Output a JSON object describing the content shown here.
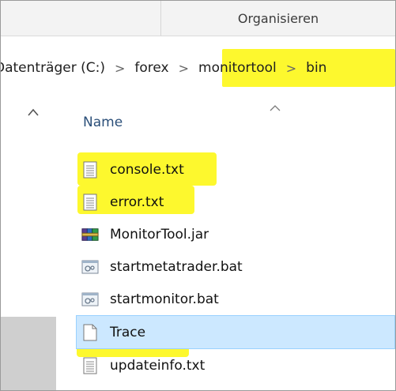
{
  "ribbon": {
    "organize_label": "Organisieren"
  },
  "address": {
    "crumbs": [
      "Datenträger (C:)",
      "forex",
      "monitortool",
      "bin"
    ],
    "separator": ">"
  },
  "columns": {
    "name_label": "Name"
  },
  "files": [
    {
      "name": "console.txt",
      "icon": "text-file-icon",
      "highlighted": true
    },
    {
      "name": "error.txt",
      "icon": "text-file-icon",
      "highlighted": true
    },
    {
      "name": "MonitorTool.jar",
      "icon": "archive-icon",
      "highlighted": false
    },
    {
      "name": "startmetatrader.bat",
      "icon": "batch-file-icon",
      "highlighted": false
    },
    {
      "name": "startmonitor.bat",
      "icon": "batch-file-icon",
      "highlighted": false
    },
    {
      "name": "Trace",
      "icon": "blank-file-icon",
      "highlighted": true,
      "selected": true
    },
    {
      "name": "updateinfo.txt",
      "icon": "text-file-icon",
      "highlighted": false
    }
  ],
  "colors": {
    "highlight": "#fdf82e",
    "selection": "#cce8ff",
    "selection_border": "#99d1ff"
  }
}
